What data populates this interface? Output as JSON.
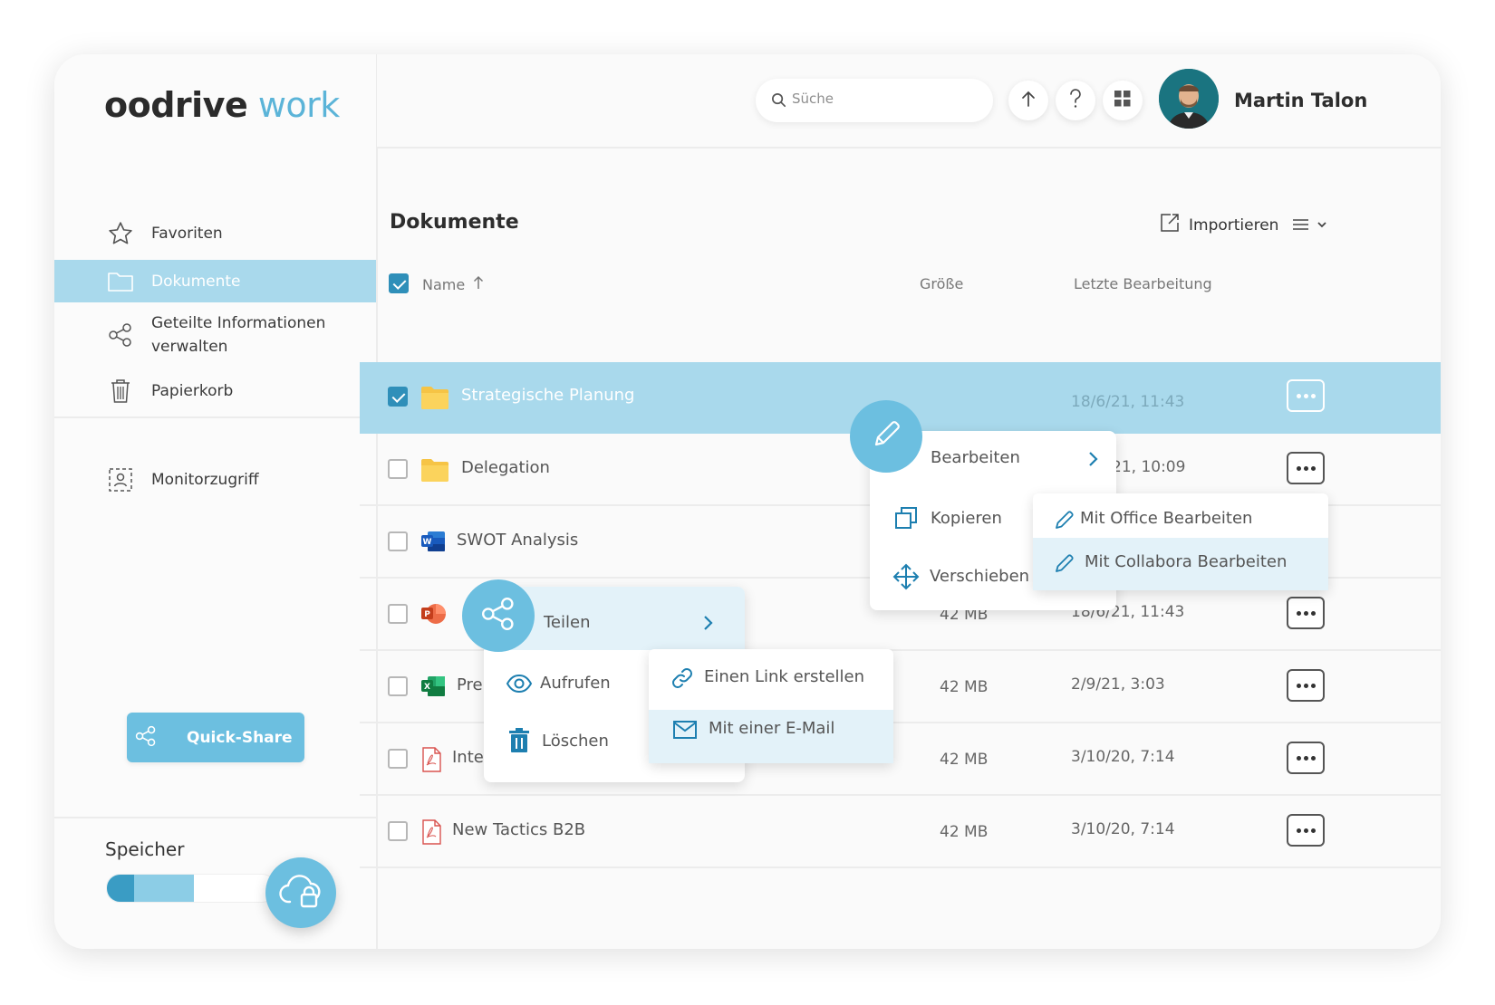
{
  "app": {
    "logo_bold": "oodrive",
    "logo_light": " work"
  },
  "sidebar": {
    "items": [
      {
        "label": "Favoriten",
        "icon": "star-icon"
      },
      {
        "label": "Dokumente",
        "icon": "folder-icon",
        "active": true
      },
      {
        "label": "Geteilte Informationen verwalten",
        "icon": "share-icon"
      },
      {
        "label": "Papierkorb",
        "icon": "trash-icon"
      },
      {
        "label": "Monitorzugriff",
        "icon": "monitor-access-icon"
      }
    ],
    "quick_share_label": "Quick-Share",
    "storage_label": "Speicher",
    "storage_used_fraction": 0.52
  },
  "header": {
    "search_placeholder": "Süche",
    "user_name": "Martin Talon"
  },
  "main": {
    "title": "Dokumente",
    "import_label": "Importieren",
    "columns": {
      "name": "Name",
      "size": "Größe",
      "modified": "Letzte Bearbeitung"
    },
    "rows": [
      {
        "name": "Strategische Planung",
        "type": "folder",
        "size": "",
        "modified": "18/6/21, 11:43",
        "selected": true
      },
      {
        "name": "Delegation",
        "type": "folder",
        "size": "",
        "modified": "21, 10:09",
        "selected": false
      },
      {
        "name": "SWOT Analysis",
        "type": "word",
        "size": "",
        "modified": "",
        "selected": false
      },
      {
        "name": "",
        "type": "powerpoint",
        "size": "42 MB",
        "modified": "18/6/21, 11:43",
        "selected": false
      },
      {
        "name": "Pre",
        "type": "excel",
        "size": "42 MB",
        "modified": "2/9/21, 3:03",
        "selected": false
      },
      {
        "name": "Inte",
        "type": "pdf",
        "size": "42 MB",
        "modified": "3/10/20, 7:14",
        "selected": false
      },
      {
        "name": "New Tactics B2B",
        "type": "pdf",
        "size": "42 MB",
        "modified": "3/10/20, 7:14",
        "selected": false
      }
    ]
  },
  "edit_menu": {
    "edit": "Bearbeiten",
    "copy": "Kopieren",
    "move": "Verschieben",
    "submenu": {
      "office": "Mit Office Bearbeiten",
      "collabora": "Mit Collabora Bearbeiten"
    }
  },
  "share_menu": {
    "share": "Teilen",
    "open": "Aufrufen",
    "delete": "Löschen",
    "submenu": {
      "link": "Einen Link erstellen",
      "email": "Mit einer E-Mail"
    }
  },
  "colors": {
    "accent": "#6cbfe0",
    "selected_row": "#a9d9ec",
    "checkbox": "#2f8fb9"
  }
}
